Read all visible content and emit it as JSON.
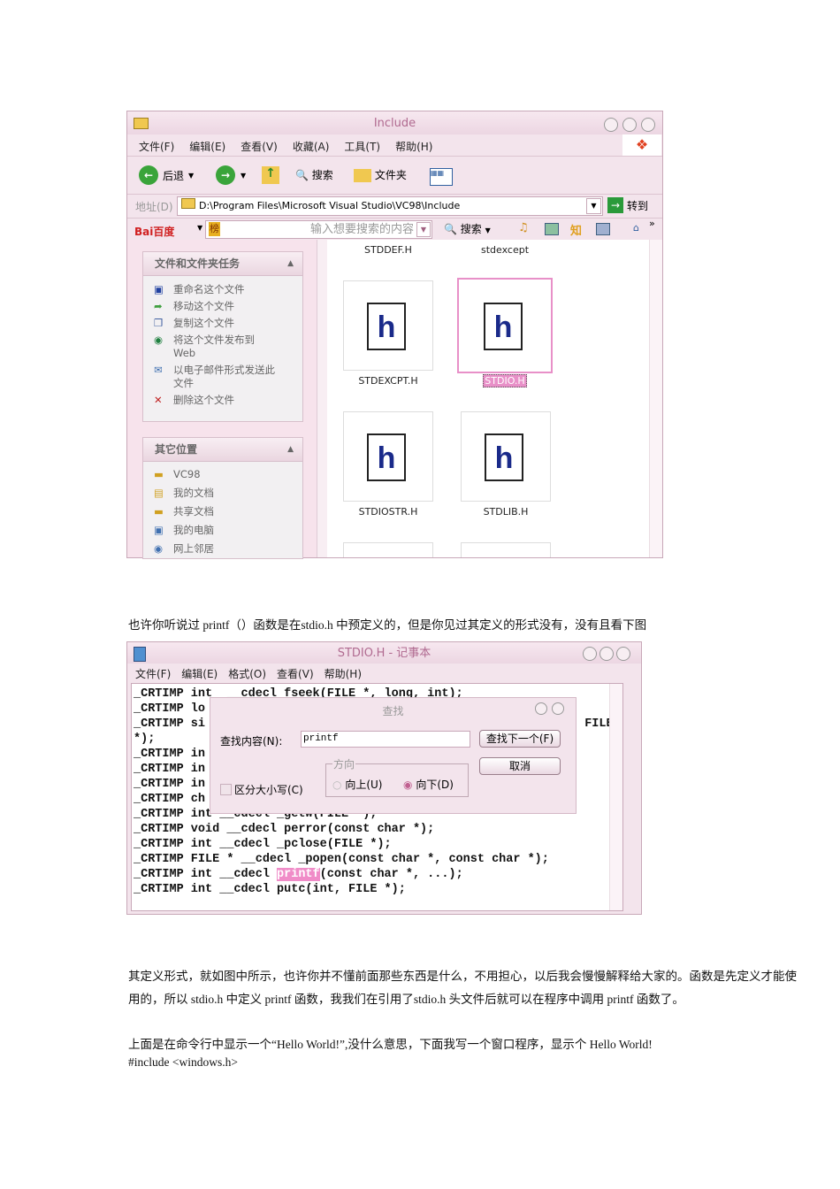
{
  "explorer": {
    "title": "Include",
    "menu": [
      "文件(F)",
      "编辑(E)",
      "查看(V)",
      "收藏(A)",
      "工具(T)",
      "帮助(H)"
    ],
    "toolbar": {
      "back": "后退",
      "search": "搜索",
      "folders": "文件夹"
    },
    "address": {
      "label": "地址(D)",
      "value": "D:\\Program Files\\Microsoft Visual Studio\\VC98\\Include",
      "go": "转到"
    },
    "baidu": {
      "logo": "Bai百度",
      "search_placeholder": "输入想要搜索的内容",
      "search": "搜索",
      "bang": "榜",
      "zhi": "知"
    },
    "tasks": {
      "title": "文件和文件夹任务",
      "items": [
        "重命名这个文件",
        "移动这个文件",
        "复制这个文件",
        "将这个文件发布到 Web",
        "以电子邮件形式发送此文件",
        "删除这个文件"
      ]
    },
    "places": {
      "title": "其它位置",
      "items": [
        "VC98",
        "我的文档",
        "共享文档",
        "我的电脑",
        "网上邻居"
      ]
    },
    "files": [
      "STDDEF.H",
      "stdexcept",
      "STDEXCPT.H",
      "STDIO.H",
      "STDIOSTR.H",
      "STDLIB.H"
    ],
    "selected_file": "STDIO.H"
  },
  "para1": "也许你听说过 printf（）函数是在stdio.h 中预定义的，但是你见过其定义的形式没有，没有且看下图",
  "notepad": {
    "title": "STDIO.H - 记事本",
    "menu": [
      "文件(F)",
      "编辑(E)",
      "格式(O)",
      "查看(V)",
      "帮助(H)"
    ],
    "lines": [
      "_CRTIMP int  __cdecl fseek(FILE *, long, int);",
      "_CRTIMP lo",
      "_CRTIMP si",
      "*);",
      "_CRTIMP in",
      "_CRTIMP in",
      "_CRTIMP in",
      "_CRTIMP ch",
      "_CRTIMP int __cdecl _getw(FILE *);",
      "_CRTIMP void __cdecl perror(const char *);",
      "_CRTIMP int __cdecl _pclose(FILE *);",
      "_CRTIMP FILE * __cdecl _popen(const char *, const char *);"
    ],
    "line3_tail": ", FILE",
    "printf_line": {
      "pre": "_CRTIMP int __cdecl ",
      "hl": "printf",
      "post": "(const char *, ...);"
    },
    "last_line": "_CRTIMP int __cdecl putc(int, FILE *);",
    "find": {
      "title": "查找",
      "label": "查找内容(N):",
      "value": "printf",
      "find_next": "查找下一个(F)",
      "cancel": "取消",
      "direction": "方向",
      "up": "向上(U)",
      "down": "向下(D)",
      "match_case": "区分大小写(C)"
    }
  },
  "para2a": "其定义形式，就如图中所示，也许你并不懂前面那些东西是什么，不用担心，以后我会慢慢解释给大家的。函数是先定义才能使",
  "para2b": "用的，所以 stdio.h 中定义 printf 函数，我我们在引用了stdio.h 头文件后就可以在程序中调用 printf 函数了。",
  "para3": "上面是在命令行中显示一个“Hello World!”,没什么意思，下面我写一个窗口程序，显示个  Hello World!",
  "para4": "#include <windows.h>"
}
